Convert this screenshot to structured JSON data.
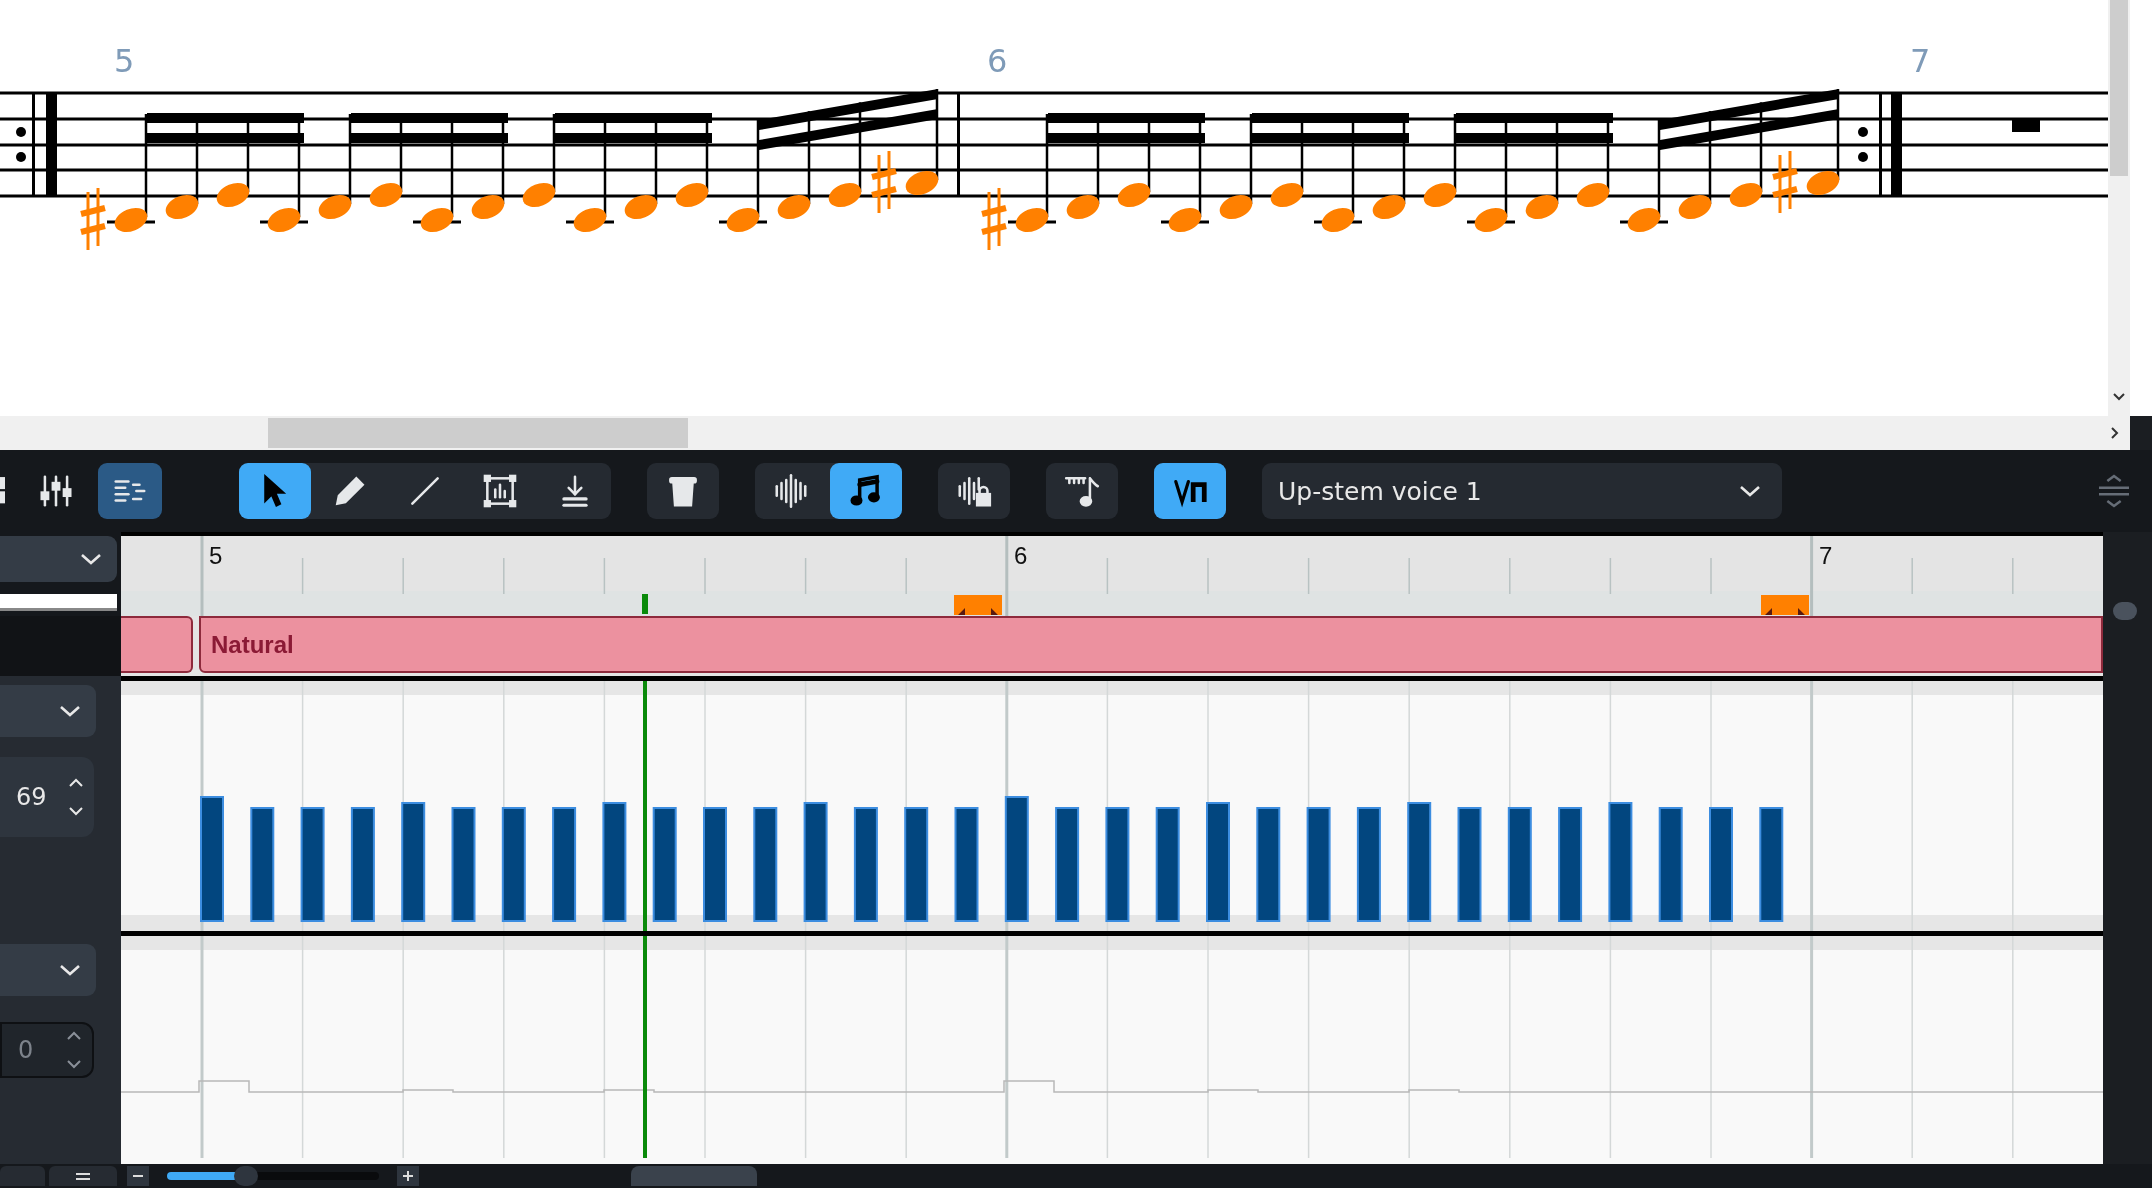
{
  "score": {
    "bar_numbers": [
      "5",
      "6",
      "7"
    ],
    "notes_selected": true
  },
  "toolbar": {
    "tool_groups": [
      [
        {
          "kind": "grid",
          "selected": false
        },
        {
          "kind": "mixer",
          "selected": false
        },
        {
          "kind": "lanes",
          "selected": true
        }
      ],
      [
        {
          "kind": "select",
          "selected": true
        },
        {
          "kind": "pencil",
          "selected": false
        },
        {
          "kind": "line",
          "selected": false
        },
        {
          "kind": "box",
          "selected": false
        },
        {
          "kind": "insert",
          "selected": false
        }
      ],
      [
        {
          "kind": "trash",
          "selected": false
        }
      ],
      [
        {
          "kind": "waveform",
          "selected": false
        },
        {
          "kind": "note",
          "selected": true
        }
      ],
      [
        {
          "kind": "waveform-lock",
          "selected": false
        }
      ],
      [
        {
          "kind": "ruler-note",
          "selected": false
        }
      ],
      [
        {
          "kind": "bowing",
          "selected": true
        }
      ]
    ],
    "voice_dropdown": {
      "value": "Up-stem voice 1"
    }
  },
  "ruler": {
    "bars": [
      "5",
      "6",
      "7"
    ]
  },
  "expression_lane": {
    "technique": "Natural"
  },
  "velocity_lane": {
    "value": "69"
  },
  "lower_lane": {
    "value": "0",
    "disabled": true
  },
  "zoom": {
    "level": 0.38
  }
}
